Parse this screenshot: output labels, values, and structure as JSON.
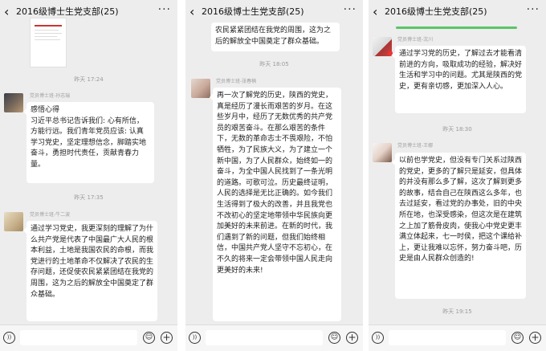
{
  "panels": [
    {
      "title": "2016级博士生党支部(25)",
      "icons": {
        "back": "chevron-left-icon",
        "more": "more-dots-icon"
      },
      "messages": [
        {
          "type": "image"
        },
        {
          "type": "timestamp",
          "text": "昨天 17:24"
        },
        {
          "type": "text",
          "sender": "党员博士班-孙志瑞",
          "text": "感悟心得\n习近平总书记告诉我们: 心有所信，方能行远。我们青年党员应该: 认真学习党史，坚定理想信念，脚踏实地奋斗，勇担时代责任，贡献青春力量。"
        },
        {
          "type": "timestamp",
          "text": "昨天 17:35"
        },
        {
          "type": "text",
          "sender": "党员博士班-牛二波",
          "text": "通过学习党史，我更深刻的理解了为什么共产党是代表了中国最广大人民的根本利益，土地是我国农民的命根，而我党进行的土地革命不仅解决了农民的生存问题，还促使农民紧紧团结在我党的周围，这为之后的解放全中国奠定了群众基础。"
        }
      ]
    },
    {
      "title": "2016级博士生党支部(25)",
      "messages": [
        {
          "type": "text",
          "text": "农民紧紧团结在我党的周围，这为之后的解放全中国奠定了群众基础。"
        },
        {
          "type": "timestamp",
          "text": "昨天 18:05"
        },
        {
          "type": "text",
          "sender": "党员博士班-张春楠",
          "text": "再一次了解党的历史，陕西的党史，真是经历了漫长而艰苦的岁月。在这些岁月中，经历了无数优秀的共产党员的艰苦奋斗。在那么艰苦的条件下，无数的革命志士不畏艰险，不怕牺牲，为了民族大义，为了建立一个新中国，为了人民群众，始终如一的奋斗，为全中国人民找到了一条光明的道路。可歌可泣。历史最终证明，人民的选择是无比正确的。如今我们生活得到了极大的改善，并且我党也不改初心的坚定地带领中华民族向更加美好的未来前进。在新的时代，我们遇到了新的问题，但我们始终相信，中国共产党人坚守不忘初心，在不久的将来一定会带领中国人民走向更美好的未来!"
        }
      ]
    },
    {
      "title": "2016级博士生党支部(25)",
      "messages": [
        {
          "type": "text",
          "sender": "党员博士班-沈川",
          "text": "通过学习党的历史，了解过去才能看清前进的方向，吸取成功的经验，解决好生活和学习中的问题。尤其是陕西的党史，更有亲切感，更加深入人心。"
        },
        {
          "type": "timestamp",
          "text": "昨天 18:30"
        },
        {
          "type": "text",
          "sender": "党员博士班-王娜",
          "text": "以前也学党史，但没有专门关系过陕西的党史，更多的了解只是延安，但具体的并没有那么多了解，这次了解到更多的故事，结合自己在陕西这么多年，也去过延安，看过党的办事处，旧的中央所在地，也深受感染，但这次是在建筑之上加了筋骨皮肉，使我心中党史更丰满立体起来，七一时侯，把这个课给补上，更让我难以忘怀，努力奋斗吧，历史是由人民群众创造的!"
        },
        {
          "type": "timestamp",
          "text": "昨天 19:15"
        }
      ]
    }
  ],
  "input_bar_icons": [
    "voice-icon",
    "emoji-icon",
    "plus-icon"
  ]
}
